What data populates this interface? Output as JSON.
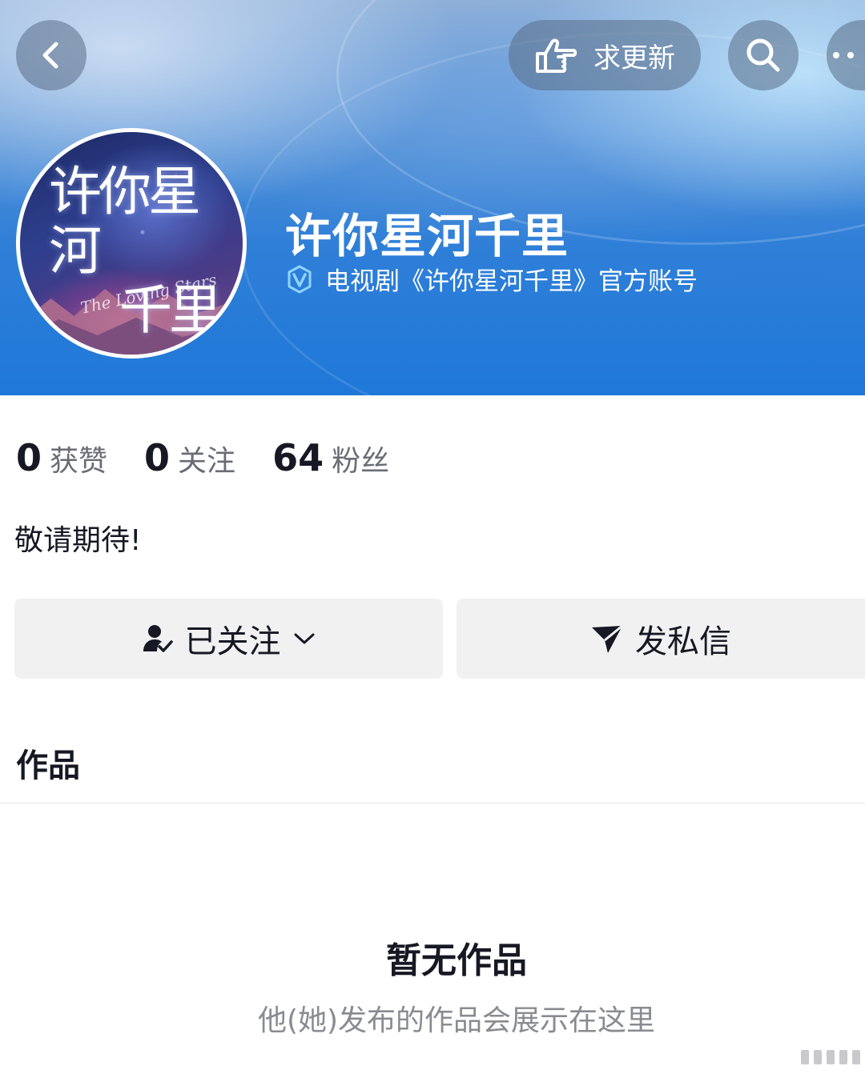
{
  "header": {
    "back_icon": "chevron-left-icon",
    "request_update_label": "求更新",
    "request_update_icon": "pointing-hand-icon",
    "search_icon": "search-icon",
    "more_icon": "more-icon"
  },
  "profile": {
    "avatar_title_line1": "许你星河",
    "avatar_title_line2": "千里",
    "avatar_subtitle": "The Loving Stars",
    "name": "许你星河千里",
    "verification_icon": "verified-v-icon",
    "verification_text": "电视剧《许你星河千里》官方账号"
  },
  "stats": [
    {
      "value": "0",
      "label": "获赞"
    },
    {
      "value": "0",
      "label": "关注"
    },
    {
      "value": "64",
      "label": "粉丝"
    }
  ],
  "bio": "敬请期待!",
  "actions": {
    "follow_label": "已关注",
    "follow_icon": "user-check-icon",
    "follow_chevron": "chevron-down-icon",
    "message_label": "发私信",
    "message_icon": "send-icon"
  },
  "works": {
    "title": "作品",
    "empty_title": "暂无作品",
    "empty_subtitle": "他(她)发布的作品会展示在这里"
  },
  "colors": {
    "banner_blue": "#2f7fd8",
    "button_bg": "#f1f1f2",
    "text_primary": "#161823",
    "text_secondary": "#6a6c75"
  }
}
